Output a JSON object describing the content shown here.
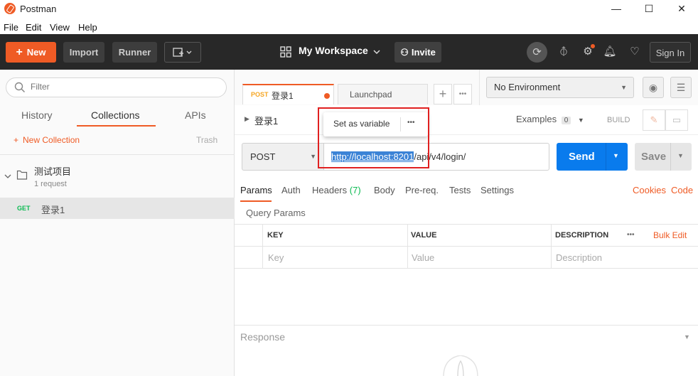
{
  "window": {
    "title": "Postman",
    "minimize": "—",
    "maximize": "☐",
    "close": "✕"
  },
  "menu": [
    "File",
    "Edit",
    "View",
    "Help"
  ],
  "toolbar": {
    "new_label": "New",
    "import_label": "Import",
    "runner_label": "Runner",
    "workspace_label": "My Workspace",
    "invite_label": "Invite",
    "signin_label": "Sign In",
    "icons": [
      "sync-off-icon",
      "satellite-icon",
      "gear-icon",
      "bell-icon",
      "heart-icon"
    ]
  },
  "sidebar": {
    "filter_placeholder": "Filter",
    "tabs": [
      "History",
      "Collections",
      "APIs"
    ],
    "active_tab": "Collections",
    "new_collection_label": "New Collection",
    "trash_label": "Trash",
    "collection": {
      "name": "测试项目",
      "count": "1 request"
    },
    "request": {
      "method": "GET",
      "name": "登录1"
    }
  },
  "tabs": [
    {
      "method": "POST",
      "name": "登录1",
      "unsaved": true
    },
    {
      "name": "Launchpad"
    }
  ],
  "environment": {
    "selected": "No Environment"
  },
  "request": {
    "breadcrumb": "登录1",
    "examples_label": "Examples",
    "examples_count": "0",
    "build_label": "BUILD",
    "method": "POST",
    "url_selected": "http://localhost:8201",
    "url_rest": "/api/v4/login/",
    "send_label": "Send",
    "save_label": "Save"
  },
  "popup": {
    "label": "Set as variable",
    "more": "•••"
  },
  "subtabs": [
    "Params",
    "Auth",
    "Headers",
    "Body",
    "Pre-req.",
    "Tests",
    "Settings"
  ],
  "headers_count": "(7)",
  "cookies_label": "Cookies",
  "code_label": "Code",
  "query_params": {
    "title": "Query Params",
    "columns": [
      "KEY",
      "VALUE",
      "DESCRIPTION"
    ],
    "bulk_edit": "Bulk Edit",
    "placeholders": [
      "Key",
      "Value",
      "Description"
    ]
  },
  "response_label": "Response",
  "colors": {
    "accent": "#ef5b25",
    "send": "#097bed",
    "highlight": "#e02020"
  }
}
